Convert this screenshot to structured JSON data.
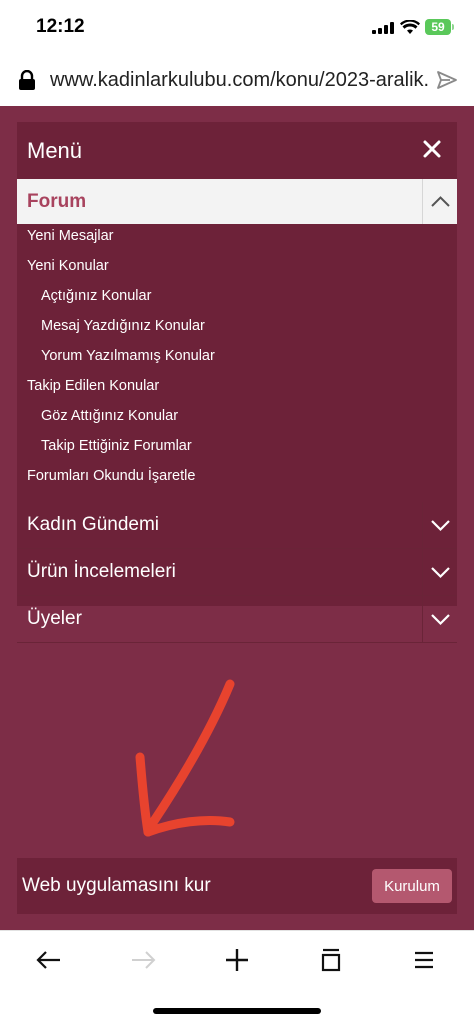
{
  "status_bar": {
    "time": "12:12",
    "battery": "59"
  },
  "url_bar": {
    "url": "www.kadinlarkulubu.com/konu/2023-aralik..."
  },
  "menu": {
    "title": "Menü",
    "forum": {
      "label": "Forum",
      "items": [
        {
          "label": "Yeni Mesajlar"
        },
        {
          "label": "Yeni Konular"
        },
        {
          "label": "Açtığınız Konular"
        },
        {
          "label": "Mesaj Yazdığınız Konular"
        },
        {
          "label": "Yorum Yazılmamış Konular"
        },
        {
          "label": "Takip Edilen Konular"
        },
        {
          "label": "Göz Attığınız Konular"
        },
        {
          "label": "Takip Ettiğiniz Forumlar"
        },
        {
          "label": "Forumları Okundu İşaretle"
        }
      ]
    },
    "sections": [
      {
        "label": "Kadın Gündemi"
      },
      {
        "label": "Ürün İncelemeleri"
      },
      {
        "label": "Üyeler"
      }
    ]
  },
  "install": {
    "text": "Web uygulamasını kur",
    "button": "Kurulum"
  },
  "colors": {
    "background": "#7d2d47",
    "panel": "#6d2239",
    "accent": "#a8435e",
    "button": "#b4586f",
    "annotation_arrow": "#e8432e"
  },
  "icons": [
    "lock-icon",
    "share-icon",
    "close-icon",
    "chevron-up-icon",
    "chevron-down-icon",
    "back-arrow-icon",
    "forward-arrow-icon",
    "plus-icon",
    "tabs-icon",
    "menu-icon"
  ]
}
